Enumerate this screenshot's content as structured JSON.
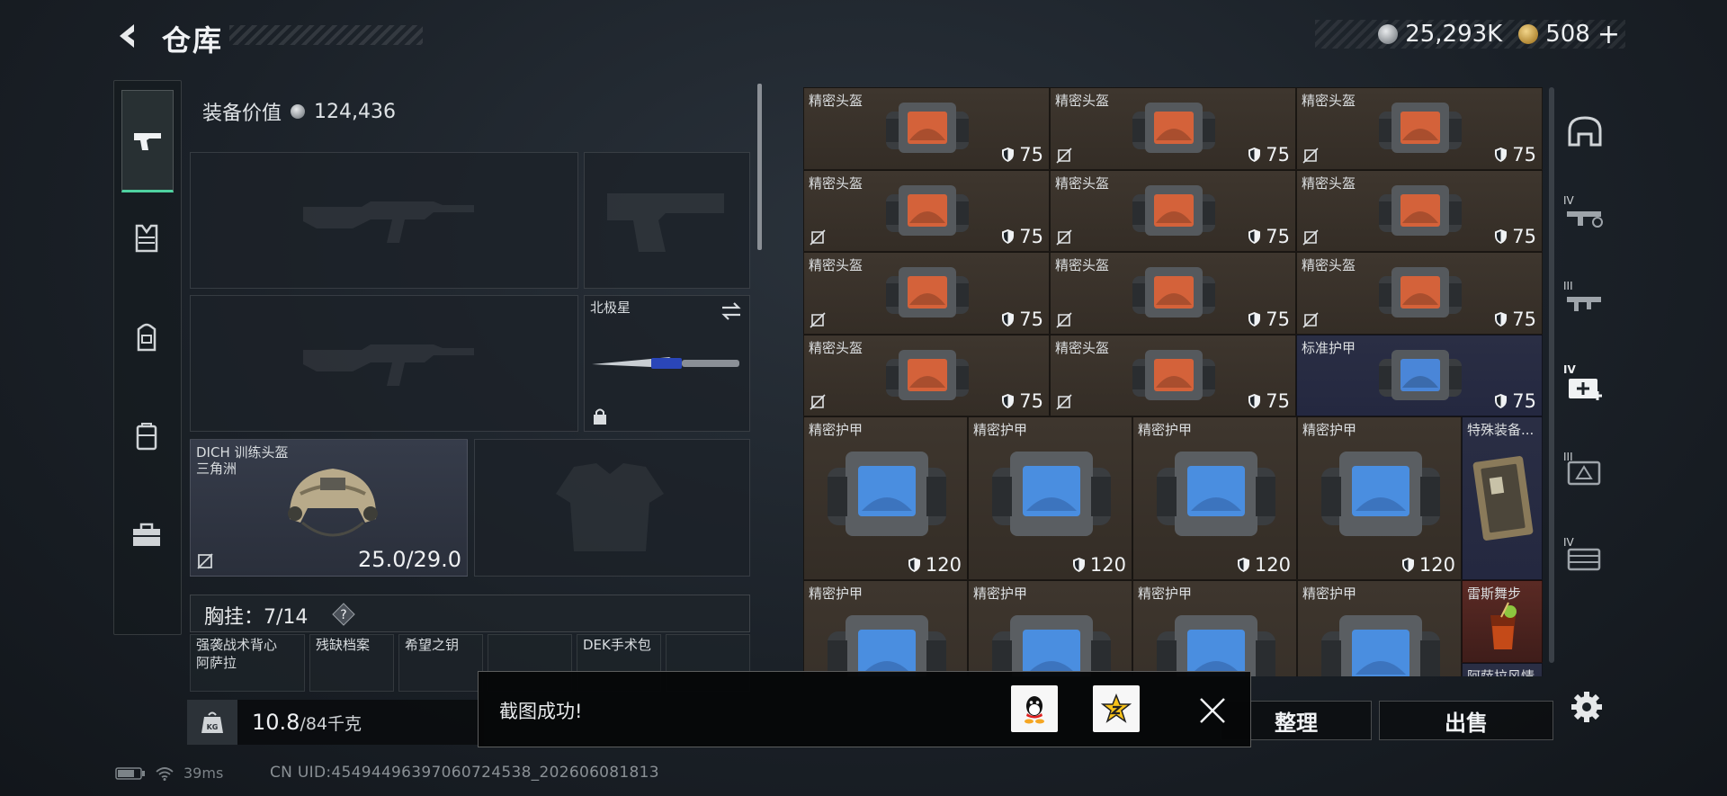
{
  "header": {
    "title": "仓库",
    "currencies": [
      {
        "icon": "silver-coin-icon",
        "value": "25,293K"
      },
      {
        "icon": "gold-coin-icon",
        "value": "508"
      }
    ],
    "add_label": "+"
  },
  "categories": [
    {
      "icon": "pistol-icon",
      "active": true
    },
    {
      "icon": "vest-icon",
      "active": false
    },
    {
      "icon": "backpack-icon",
      "active": false
    },
    {
      "icon": "case-icon",
      "active": false
    },
    {
      "icon": "toolbox-icon",
      "active": false
    }
  ],
  "equipment": {
    "value_label": "装备价值",
    "value": "124,436",
    "melee_name": "北极星",
    "helmet_name": "DICH 训练头盔",
    "helmet_map": "三角洲",
    "helmet_durability": "25.0/29.0",
    "chest_label": "胸挂：",
    "chest_capacity": "7/14",
    "chest_help": "?",
    "chest_items": [
      {
        "name": "强袭战术背心",
        "sub": "阿萨拉"
      },
      {
        "name": "残缺档案",
        "sub": ""
      },
      {
        "name": "希望之钥",
        "sub": ""
      },
      {
        "name": "",
        "sub": ""
      },
      {
        "name": "DEK手术包",
        "sub": ""
      },
      {
        "name": "",
        "sub": ""
      }
    ]
  },
  "weight": {
    "current": "10.8",
    "max": "/84千克",
    "icon": "kg-weight-icon"
  },
  "storage": {
    "items": [
      {
        "name": "精密头盔",
        "value": "75",
        "kind": "helmet",
        "bg": "brown",
        "no_insure": false
      },
      {
        "name": "精密头盔",
        "value": "75",
        "kind": "helmet",
        "bg": "brown",
        "no_insure": true
      },
      {
        "name": "精密头盔",
        "value": "75",
        "kind": "helmet",
        "bg": "brown",
        "no_insure": true
      },
      {
        "name": "精密头盔",
        "value": "75",
        "kind": "helmet",
        "bg": "brown",
        "no_insure": true
      },
      {
        "name": "精密头盔",
        "value": "75",
        "kind": "helmet",
        "bg": "brown",
        "no_insure": true
      },
      {
        "name": "精密头盔",
        "value": "75",
        "kind": "helmet",
        "bg": "brown",
        "no_insure": true
      },
      {
        "name": "精密头盔",
        "value": "75",
        "kind": "helmet",
        "bg": "brown",
        "no_insure": true
      },
      {
        "name": "精密头盔",
        "value": "75",
        "kind": "helmet",
        "bg": "brown",
        "no_insure": true
      },
      {
        "name": "精密头盔",
        "value": "75",
        "kind": "helmet",
        "bg": "brown",
        "no_insure": true
      },
      {
        "name": "精密头盔",
        "value": "75",
        "kind": "helmet",
        "bg": "brown",
        "no_insure": true
      },
      {
        "name": "精密头盔",
        "value": "75",
        "kind": "helmet",
        "bg": "brown",
        "no_insure": true
      },
      {
        "name": "标准护甲",
        "value": "75",
        "kind": "helmet-blue",
        "bg": "blue",
        "no_insure": false
      },
      {
        "name": "精密护甲",
        "value": "120",
        "kind": "armor",
        "bg": "brown",
        "no_insure": false
      },
      {
        "name": "精密护甲",
        "value": "120",
        "kind": "armor",
        "bg": "brown",
        "no_insure": false
      },
      {
        "name": "精密护甲",
        "value": "120",
        "kind": "armor",
        "bg": "brown",
        "no_insure": false
      },
      {
        "name": "精密护甲",
        "value": "120",
        "kind": "armor",
        "bg": "brown",
        "no_insure": false
      },
      {
        "name": "特殊装备...",
        "value": "",
        "kind": "case",
        "bg": "blue",
        "no_insure": false
      },
      {
        "name": "精密护甲",
        "value": "",
        "kind": "armor",
        "bg": "brown",
        "no_insure": false
      },
      {
        "name": "精密护甲",
        "value": "",
        "kind": "armor",
        "bg": "brown",
        "no_insure": false
      },
      {
        "name": "精密护甲",
        "value": "",
        "kind": "armor",
        "bg": "brown",
        "no_insure": false
      },
      {
        "name": "精密护甲",
        "value": "",
        "kind": "armor",
        "bg": "brown",
        "no_insure": false
      },
      {
        "name": "雷斯舞步",
        "value": "",
        "kind": "drink",
        "bg": "red",
        "no_insure": false
      },
      {
        "name": "阿萨拉风情",
        "value": "",
        "kind": "drink",
        "bg": "blue",
        "no_insure": false
      }
    ]
  },
  "side_categories": [
    {
      "icon": "helmet-category-icon",
      "tier": ""
    },
    {
      "icon": "rifle-category-icon",
      "tier": "IV"
    },
    {
      "icon": "smg-category-icon",
      "tier": "III"
    },
    {
      "icon": "medkit-category-icon",
      "tier": "IV"
    },
    {
      "icon": "armor-category-icon",
      "tier": "III"
    },
    {
      "icon": "case-category-icon",
      "tier": "IV"
    }
  ],
  "buttons": {
    "sort": "整理",
    "sell": "出售"
  },
  "toast": {
    "text": "截图成功!",
    "share_icons": [
      "qq-share-icon",
      "qzone-share-icon"
    ]
  },
  "footer": {
    "ping": "39ms",
    "uid": "CN UID:45494496397060724538_202606081813"
  }
}
